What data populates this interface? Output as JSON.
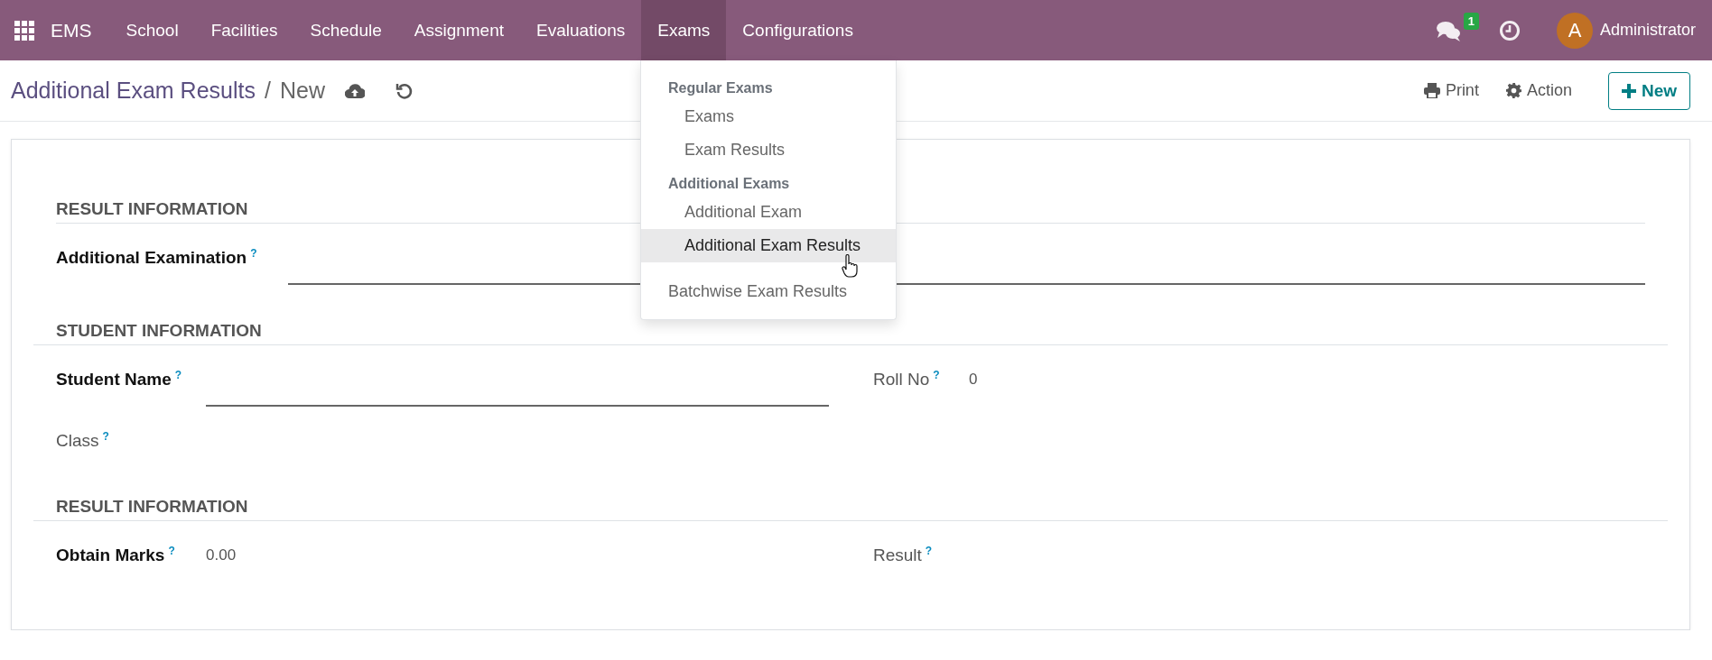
{
  "navbar": {
    "app_name": "EMS",
    "menu": [
      {
        "label": "School",
        "selected": false
      },
      {
        "label": "Facilities",
        "selected": false
      },
      {
        "label": "Schedule",
        "selected": false
      },
      {
        "label": "Assignment",
        "selected": false
      },
      {
        "label": "Evaluations",
        "selected": false
      },
      {
        "label": "Exams",
        "selected": true
      },
      {
        "label": "Configurations",
        "selected": false
      }
    ],
    "messages_badge": "1",
    "user": {
      "initial": "A",
      "name": "Administrator"
    }
  },
  "dropdown": [
    {
      "kind": "header",
      "label": "Regular Exams"
    },
    {
      "kind": "item",
      "label": "Exams",
      "selected": false
    },
    {
      "kind": "item",
      "label": "Exam Results",
      "selected": false
    },
    {
      "kind": "header",
      "label": "Additional Exams"
    },
    {
      "kind": "item",
      "label": "Additional Exam",
      "selected": false
    },
    {
      "kind": "item",
      "label": "Additional Exam Results",
      "selected": true
    },
    {
      "kind": "top",
      "label": "Batchwise Exam Results",
      "selected": false
    }
  ],
  "control_panel": {
    "breadcrumb": "Additional Exam Results",
    "separator": "/",
    "current": "New",
    "print": "Print",
    "action": "Action",
    "new_button": "New"
  },
  "form": {
    "sections": [
      {
        "title": "RESULT INFORMATION",
        "columns": [
          [
            {
              "label": "Additional Examination",
              "tooltip": "?",
              "required": true,
              "kind": "input"
            }
          ]
        ]
      },
      {
        "title": "STUDENT INFORMATION",
        "columns": [
          [
            {
              "label": "Student Name",
              "tooltip": "?",
              "required": true,
              "kind": "input"
            },
            {
              "label": "Class",
              "tooltip": "?",
              "required": false,
              "kind": "value"
            }
          ],
          [
            {
              "label": "Roll No",
              "tooltip": "?",
              "required": false,
              "kind": "value",
              "value": "0"
            }
          ]
        ]
      },
      {
        "title": "RESULT INFORMATION",
        "columns": [
          [
            {
              "label": "Obtain Marks",
              "tooltip": "?",
              "required": true,
              "kind": "value",
              "value": "0.00"
            }
          ],
          [
            {
              "label": "Result",
              "tooltip": "?",
              "required": false,
              "kind": "value"
            }
          ]
        ]
      }
    ]
  }
}
